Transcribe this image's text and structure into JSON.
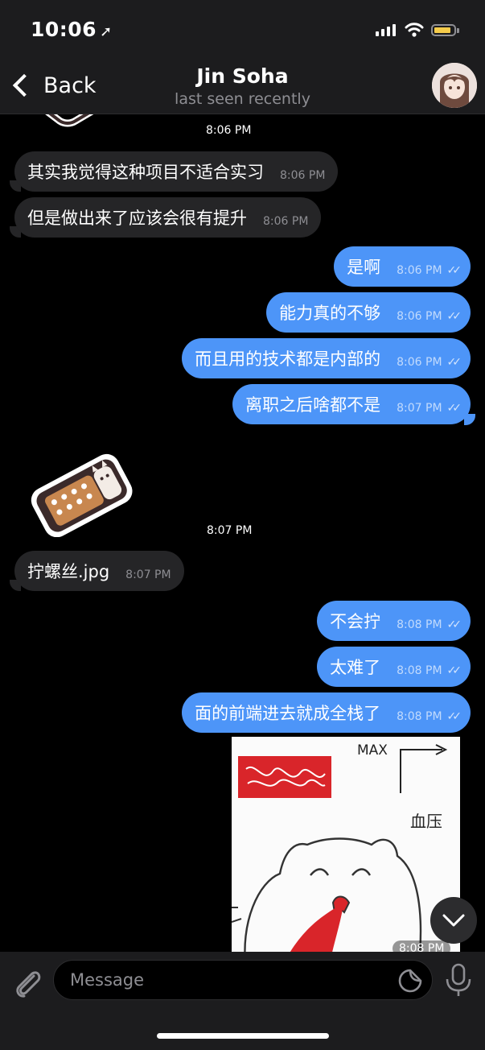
{
  "status_bar": {
    "time": "10:06",
    "location_arrow": "location-arrow-icon",
    "signal": "signal-bars-icon",
    "wifi": "wifi-icon",
    "battery": "battery-icon",
    "battery_color": "#f5cc4b"
  },
  "header": {
    "back_label": "Back",
    "title": "Jin Soha",
    "subtitle": "last seen recently"
  },
  "messages": [
    {
      "type": "sticker-partial",
      "time": "8:06 PM"
    },
    {
      "direction": "in",
      "text": "其实我觉得这种项目不适合实习",
      "time": "8:06 PM"
    },
    {
      "direction": "in",
      "text": "但是做出来了应该会很有提升",
      "time": "8:06 PM"
    },
    {
      "direction": "out",
      "text": "是啊",
      "time": "8:06 PM",
      "status": "read"
    },
    {
      "direction": "out",
      "text": "能力真的不够",
      "time": "8:06 PM",
      "status": "read"
    },
    {
      "direction": "out",
      "text": "而且用的技术都是内部的",
      "time": "8:06 PM",
      "status": "read"
    },
    {
      "direction": "out",
      "text": "离职之后啥都不是",
      "time": "8:07 PM",
      "status": "read"
    },
    {
      "type": "sticker",
      "time": "8:07 PM"
    },
    {
      "direction": "in",
      "text": "拧螺丝.jpg",
      "time": "8:07 PM"
    },
    {
      "direction": "out",
      "text": "不会拧",
      "time": "8:08 PM",
      "status": "read"
    },
    {
      "direction": "out",
      "text": "太难了",
      "time": "8:08 PM",
      "status": "read"
    },
    {
      "direction": "out",
      "text": "面的前端进去就成全栈了",
      "time": "8:08 PM",
      "status": "read"
    },
    {
      "type": "photo",
      "time": "8:08 PM",
      "image_text": [
        "MAX",
        "血压"
      ]
    }
  ],
  "read_receipt": "✓✓",
  "composer": {
    "placeholder": "Message"
  },
  "colors": {
    "outgoing_bubble": "#4d95f8",
    "incoming_bubble": "#252527",
    "background": "#000000"
  }
}
